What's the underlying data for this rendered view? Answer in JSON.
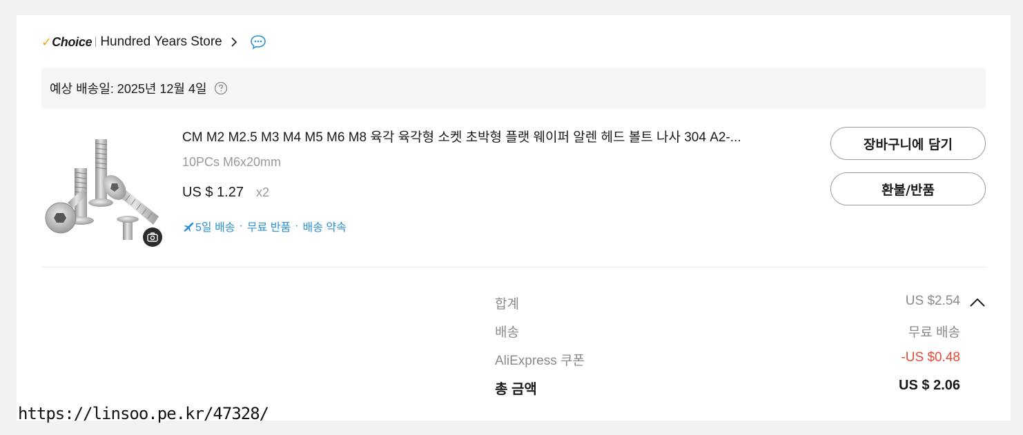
{
  "store": {
    "badge_check": "✓",
    "badge_label": "Choice",
    "name": "Hundred Years Store"
  },
  "delivery": {
    "estimate": "예상 배송일: 2025년 12월 4일"
  },
  "product": {
    "title": "CM M2 M2.5 M3 M4 M5 M6 M8 육각 육각형 소켓 초박형 플랫 웨이퍼 알렌 헤드 볼트 나사 304 A2-...",
    "variant": "10PCs M6x20mm",
    "price": "US $ 1.27",
    "quantity": "x2",
    "perks": [
      "5일 배송",
      "무료 반품",
      "배송 약속"
    ],
    "perk_separator": "·"
  },
  "actions": {
    "add_to_cart": "장바구니에 담기",
    "refund_return": "환불/반품"
  },
  "summary": {
    "subtotal_label": "합계",
    "subtotal_value": "US $2.54",
    "shipping_label": "배송",
    "shipping_value": "무료 배송",
    "coupon_label": "AliExpress 쿠폰",
    "coupon_value": "-US $0.48",
    "total_label": "총 금액",
    "total_value": "US $ 2.06"
  },
  "watermark": "https://linsoo.pe.kr/47328/",
  "colors": {
    "background": "#f2f2f2",
    "card": "#ffffff",
    "choice_accent": "#f7a518",
    "link_blue": "#2b8fd6",
    "discount_red": "#e5493a"
  },
  "icons": [
    "chevron-right-icon",
    "chat-icon",
    "help-icon",
    "camera-icon",
    "plane-icon",
    "caret-up-icon"
  ]
}
